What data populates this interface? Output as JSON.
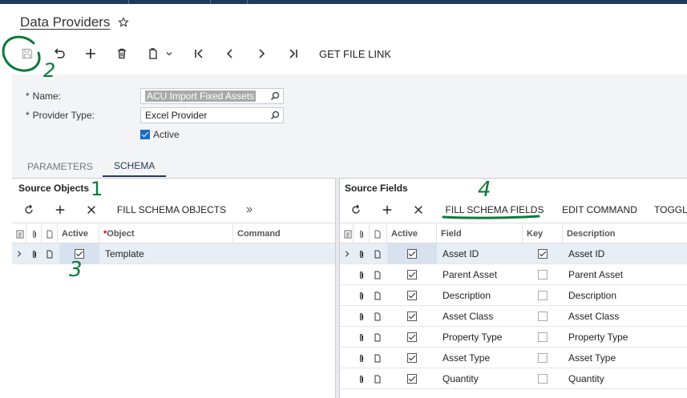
{
  "window": {
    "title": "Data Providers"
  },
  "toolbar": {
    "save": "save-icon",
    "undo": "undo-icon",
    "add": "plus-icon",
    "delete": "trash-icon",
    "copy": "copy-paste-icon",
    "first": "first-icon",
    "prev": "prev-icon",
    "next": "next-icon",
    "last": "last-icon",
    "get_file_link": "GET FILE LINK"
  },
  "form": {
    "name_label": "Name:",
    "name_value": "ACU Import Fixed Assets",
    "provider_type_label": "Provider Type:",
    "provider_type_value": "Excel Provider",
    "active_label": "Active",
    "active_checked": true
  },
  "tabs": [
    {
      "label": "PARAMETERS",
      "active": false
    },
    {
      "label": "SCHEMA",
      "active": true
    }
  ],
  "source_objects": {
    "title": "Source Objects",
    "fill_button": "FILL SCHEMA OBJECTS",
    "columns": {
      "active": "Active",
      "object": "Object",
      "command": "Command"
    },
    "rows": [
      {
        "active": true,
        "object": "Template",
        "command": ""
      }
    ]
  },
  "source_fields": {
    "title": "Source Fields",
    "fill_button": "FILL SCHEMA FIELDS",
    "edit_command": "EDIT COMMAND",
    "toggle": "TOGGL",
    "columns": {
      "active": "Active",
      "field": "Field",
      "key": "Key",
      "description": "Description"
    },
    "rows": [
      {
        "active": true,
        "field": "Asset ID",
        "key": true,
        "description": "Asset ID"
      },
      {
        "active": true,
        "field": "Parent Asset",
        "key": false,
        "description": "Parent Asset"
      },
      {
        "active": true,
        "field": "Description",
        "key": false,
        "description": "Description"
      },
      {
        "active": true,
        "field": "Asset Class",
        "key": false,
        "description": "Asset Class"
      },
      {
        "active": true,
        "field": "Property Type",
        "key": false,
        "description": "Property Type"
      },
      {
        "active": true,
        "field": "Asset Type",
        "key": false,
        "description": "Asset Type"
      },
      {
        "active": true,
        "field": "Quantity",
        "key": false,
        "description": "Quantity"
      }
    ]
  },
  "annotations": {
    "n1": "1",
    "n2": "2",
    "n3": "3",
    "n4": "4",
    "color": "#0a7a3a"
  }
}
